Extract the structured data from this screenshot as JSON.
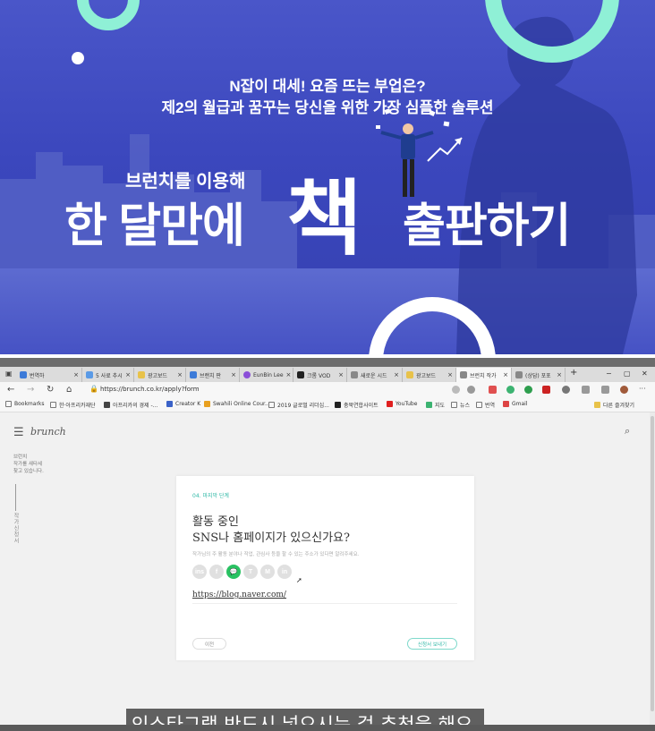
{
  "banner": {
    "line1": "N잡이 대세! 요즘 뜨는 부업은?",
    "line2": "제2의 월급과 꿈꾸는 당신을 위한 가장 심플한 솔루션",
    "small": "브런치를 이용해",
    "big_left": "한 달만에",
    "big_center": "책",
    "big_right": "출판하기",
    "colors": {
      "bg": "#3b47bd",
      "ring": "#8ff0d6"
    }
  },
  "browser": {
    "tabs": [
      {
        "label": "번역하",
        "color": "#3d7bd8"
      },
      {
        "label": "5 사료 추시",
        "color": "#5a9ae6"
      },
      {
        "label": "광고보드",
        "color": "#e8c24a"
      },
      {
        "label": "브랜치 판",
        "color": "#3d7bd8"
      },
      {
        "label": "EunBin Lee",
        "color": "#8b4fd8"
      },
      {
        "label": "크롬 VOD",
        "color": "#222222"
      },
      {
        "label": "새로운 시드",
        "color": "#888888"
      },
      {
        "label": "광고보드",
        "color": "#e8c24a"
      },
      {
        "label": "브런치 작가",
        "color": "#888888"
      },
      {
        "label": "(상담) 포포",
        "color": "#888888"
      }
    ],
    "close_glyph": "×",
    "new_tab": "+",
    "win_min": "−",
    "win_max": "▢",
    "win_close": "✕",
    "url": "https://brunch.co.kr/apply?form",
    "bookmarks": [
      "Bookmarks",
      "한·아프리카재단",
      "아프리카의 경제 -...",
      "Creator K",
      "Swahili Online Cour...",
      "2019 글로벌 리더십...",
      "충북연합사이트",
      "YouTube",
      "지도",
      "뉴스",
      "번역",
      "Gmail"
    ],
    "other_bookmarks": "다른 즐겨찾기"
  },
  "brunch": {
    "logo": "brunch",
    "side_text": [
      "브런치",
      "작가를 새타세",
      "찾고 있습니다."
    ],
    "side_vertical": "작가신청서",
    "step": "04. 마지막 단계",
    "question_line1": "활동 중인",
    "question_line2": "SNS나 홈페이지가 있으신가요?",
    "hint": "작가님의 주 활동 분야나 작업, 관심사 등을 할 수 있는 주소가 있다면 알려주세요.",
    "sns": [
      "ins",
      "f",
      "💬",
      "T",
      "M",
      "in"
    ],
    "link_value": "https://blog.naver.com/",
    "prev_button": "이전",
    "submit_button": "신청서 보내기"
  },
  "subtitle": "인스타그램 반드시 넣으시는 걸 추천을 해요."
}
